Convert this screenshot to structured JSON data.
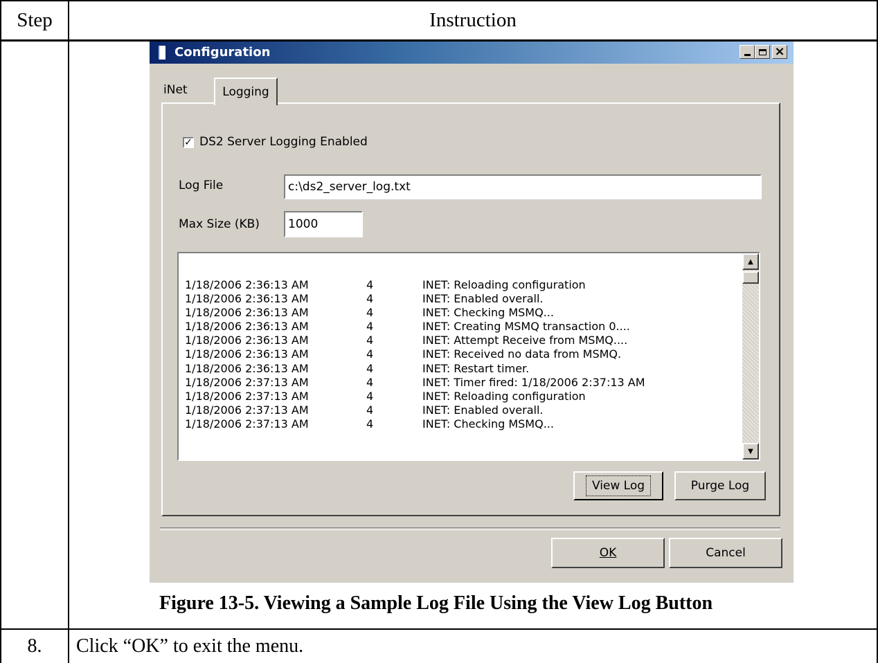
{
  "table": {
    "header_step": "Step",
    "header_instruction": "Instruction",
    "row_step": "8.",
    "row_instruction": "Click “OK” to exit the menu."
  },
  "figure_caption": "Figure 13-5.  Viewing a Sample Log File Using the View Log Button",
  "dialog": {
    "title": "Configuration",
    "window_buttons": [
      "minimize-icon",
      "maximize-icon",
      "close-icon"
    ],
    "close_glyph": "×",
    "tabs": [
      {
        "label": "iNet",
        "active": false
      },
      {
        "label": "Logging",
        "active": true
      }
    ],
    "logging_enabled_label": "DS2 Server Logging Enabled",
    "logging_enabled_checked": true,
    "checkmark": "✓",
    "log_file_label": "Log File",
    "log_file_value": "c:\\ds2_server_log.txt",
    "max_size_label": "Max Size (KB)",
    "max_size_value": "1000",
    "log_entries": [
      {
        "time": "1/18/2006 2:36:13 AM",
        "level": "4",
        "message": "INET: Reloading configuration"
      },
      {
        "time": "1/18/2006 2:36:13 AM",
        "level": "4",
        "message": "INET: Enabled overall."
      },
      {
        "time": "1/18/2006 2:36:13 AM",
        "level": "4",
        "message": "INET: Checking MSMQ..."
      },
      {
        "time": "1/18/2006 2:36:13 AM",
        "level": "4",
        "message": "INET: Creating MSMQ transaction 0...."
      },
      {
        "time": "1/18/2006 2:36:13 AM",
        "level": "4",
        "message": "INET: Attempt Receive from MSMQ...."
      },
      {
        "time": "1/18/2006 2:36:13 AM",
        "level": "4",
        "message": "INET: Received no data from MSMQ."
      },
      {
        "time": "1/18/2006 2:36:13 AM",
        "level": "4",
        "message": "INET: Restart timer."
      },
      {
        "time": "1/18/2006 2:37:13 AM",
        "level": "4",
        "message": "INET: Timer fired: 1/18/2006 2:37:13 AM"
      },
      {
        "time": "1/18/2006 2:37:13 AM",
        "level": "4",
        "message": "INET: Reloading configuration"
      },
      {
        "time": "1/18/2006 2:37:13 AM",
        "level": "4",
        "message": "INET: Enabled overall."
      },
      {
        "time": "1/18/2006 2:37:13 AM",
        "level": "4",
        "message": "INET: Checking MSMQ..."
      }
    ],
    "scroll_up_glyph": "▲",
    "scroll_down_glyph": "▼",
    "view_log_label": "View Log",
    "purge_log_label": "Purge Log",
    "ok_label": "OK",
    "cancel_label": "Cancel"
  }
}
